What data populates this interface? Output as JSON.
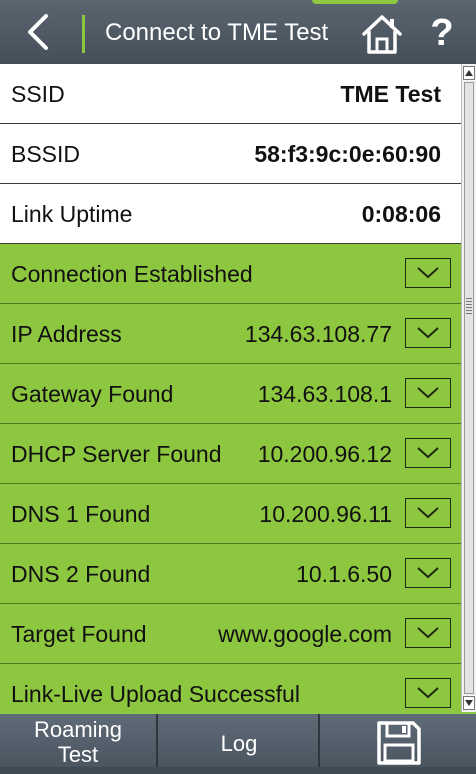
{
  "header": {
    "title": "Connect to TME Test",
    "back_icon": "chevron-left-icon",
    "home_icon": "home-icon",
    "help_label": "?"
  },
  "info_rows": [
    {
      "label": "SSID",
      "value": "TME Test"
    },
    {
      "label": "BSSID",
      "value": "58:f3:9c:0e:60:90"
    },
    {
      "label": "Link Uptime",
      "value": "0:08:06"
    }
  ],
  "status_rows": [
    {
      "label": "Connection Established",
      "value": ""
    },
    {
      "label": "IP Address",
      "value": "134.63.108.77"
    },
    {
      "label": "Gateway Found",
      "value": "134.63.108.1"
    },
    {
      "label": "DHCP Server Found",
      "value": "10.200.96.12"
    },
    {
      "label": "DNS 1 Found",
      "value": "10.200.96.11"
    },
    {
      "label": "DNS 2 Found",
      "value": "10.1.6.50"
    },
    {
      "label": "Target Found",
      "value": "www.google.com"
    },
    {
      "label": "Link-Live Upload Successful",
      "value": ""
    }
  ],
  "bottom_bar": {
    "roaming_line1": "Roaming",
    "roaming_line2": "Test",
    "log_label": "Log",
    "save_icon": "save-icon"
  },
  "colors": {
    "success_green": "#8dc63f",
    "header_bg": "#4f5a65",
    "row_white": "#ffffff"
  }
}
